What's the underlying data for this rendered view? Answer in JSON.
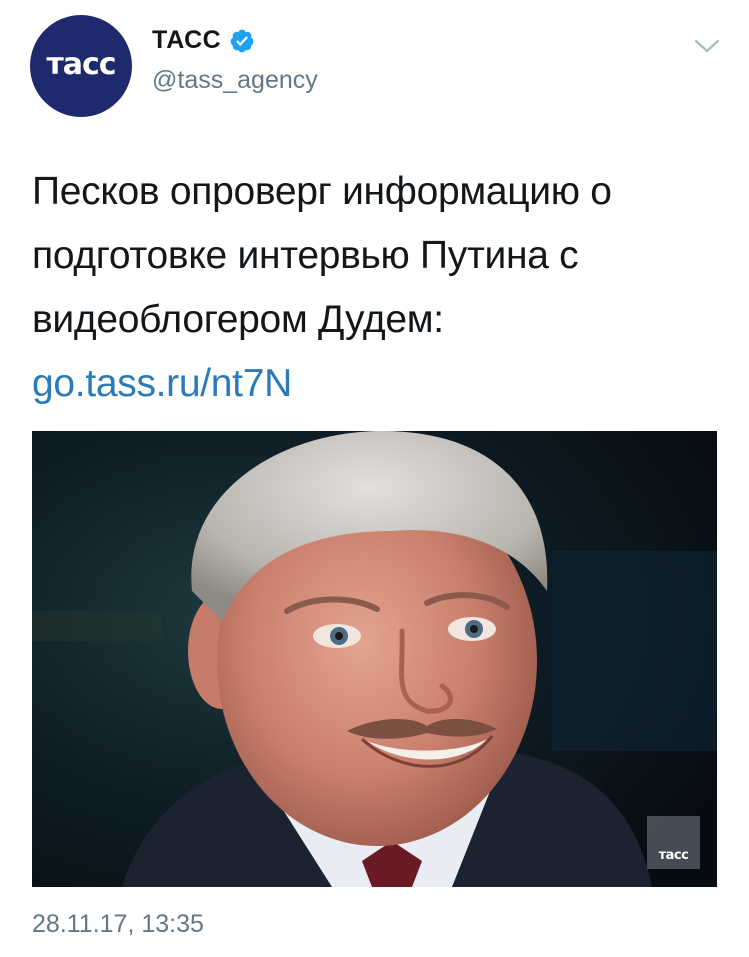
{
  "account": {
    "avatar_text": "тасс",
    "display_name": "ТАСС",
    "handle": "@tass_agency",
    "verified": true,
    "avatar_color": "#1f2a6e",
    "verified_color": "#1da1f2"
  },
  "tweet": {
    "text_lines": [
      "Песков опроверг информацию о",
      "подготовке интервью Путина с",
      "видеоблогером Дудем:"
    ],
    "link": "go.tass.ru/nt7N",
    "link_color": "#2b7bb9",
    "timestamp": "28.11.17, 13:35"
  },
  "media": {
    "watermark": "тасс"
  }
}
